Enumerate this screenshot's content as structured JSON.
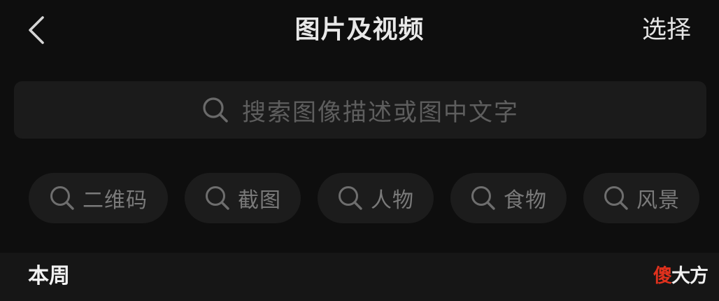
{
  "header": {
    "back_icon": "chevron-left-icon",
    "title": "图片及视频",
    "select_label": "选择"
  },
  "search": {
    "icon": "search-icon",
    "placeholder": "搜索图像描述或图中文字"
  },
  "chips": [
    {
      "icon": "search-icon",
      "label": "二维码"
    },
    {
      "icon": "search-icon",
      "label": "截图"
    },
    {
      "icon": "search-icon",
      "label": "人物"
    },
    {
      "icon": "search-icon",
      "label": "食物"
    },
    {
      "icon": "search-icon",
      "label": "风景"
    }
  ],
  "section": {
    "title": "本周"
  },
  "watermark": {
    "first_char": "傻",
    "rest": "大方",
    "accent_color": "#e0311d"
  },
  "colors": {
    "background": "#0e0e0e",
    "search_bg": "#1b1b1b",
    "chip_bg": "#1c1c1c",
    "text_primary": "#e8e8e8",
    "text_muted": "#7a7a7a"
  }
}
